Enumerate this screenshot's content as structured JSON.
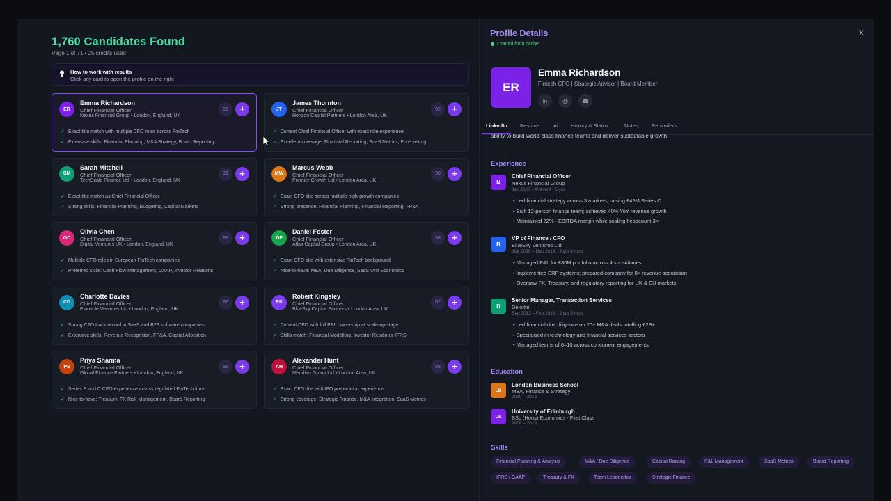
{
  "results": {
    "title": "1,760 Candidates Found",
    "subtitle": "Page 1 of 71 • 25 credits used",
    "hint_title": "How to work with results",
    "hint_text": "Click any card to open the profile on the right"
  },
  "candidates": [
    {
      "initials": "ER",
      "name": "Emma Richardson",
      "role": "Chief Financial Officer",
      "company": "Nexus Financial Group • London, England, UK",
      "score": "95",
      "r1": "Exact title match with multiple CFO roles across FinTech",
      "r2": "Extensive skills: Financial Planning, M&A Strategy, Board Reporting",
      "color": "#7c22e8"
    },
    {
      "initials": "JT",
      "name": "James Thornton",
      "role": "Chief Financial Officer",
      "company": "Horizon Capital Partners • London Area, UK",
      "score": "92",
      "r1": "Current Chief Financial Officer with exact role experience",
      "r2": "Excellent coverage: Financial Reporting, SaaS Metrics, Forecasting",
      "color": "#2563eb"
    },
    {
      "initials": "SM",
      "name": "Sarah Mitchell",
      "role": "Chief Financial Officer",
      "company": "TechScale Finance Ltd • London, England, UK",
      "score": "91",
      "r1": "Exact title match as Chief Financial Officer",
      "r2": "Strong skills: Financial Planning, Budgeting, Capital Markets",
      "color": "#0f9f74"
    },
    {
      "initials": "MW",
      "name": "Marcus Webb",
      "role": "Chief Financial Officer",
      "company": "Premier Growth Ltd • London Area, UK",
      "score": "90",
      "r1": "Exact CFO title across multiple high-growth companies",
      "r2": "Strong presence: Financial Planning, Financial Reporting, FP&A",
      "color": "#d9771a"
    },
    {
      "initials": "OC",
      "name": "Olivia Chen",
      "role": "Chief Financial Officer",
      "company": "Digital Ventures UK • London, England, UK",
      "score": "89",
      "r1": "Multiple CFO roles in European FinTech companies",
      "r2": "Preferred skills: Cash Flow Management, GAAP, Investor Relations",
      "color": "#db2777"
    },
    {
      "initials": "DF",
      "name": "Daniel Foster",
      "role": "Chief Financial Officer",
      "company": "Atlas Capital Group • London Area, UK",
      "score": "88",
      "r1": "Exact CFO title with extensive FinTech background",
      "r2": "Nice-to-have: M&A, Due Diligence, SaaS Unit Economics",
      "color": "#16a34a"
    },
    {
      "initials": "CD",
      "name": "Charlotte Davies",
      "role": "Chief Financial Officer",
      "company": "Pinnacle Ventures Ltd • London, England, UK",
      "score": "87",
      "r1": "Strong CFO track record in SaaS and B2B software companies",
      "r2": "Extensive skills: Revenue Recognition, FP&A, Capital Allocation",
      "color": "#0e8fb0"
    },
    {
      "initials": "RK",
      "name": "Robert Kingsley",
      "role": "Chief Financial Officer",
      "company": "BlueSky Capital Partners • London Area, UK",
      "score": "87",
      "r1": "Current CFO with full P&L ownership at scale-up stage",
      "r2": "Skills match: Financial Modelling, Investor Relations, IFRS",
      "color": "#7c3aed"
    },
    {
      "initials": "PS",
      "name": "Priya Sharma",
      "role": "Chief Financial Officer",
      "company": "Global Finance Partners • London, England, UK",
      "score": "86",
      "r1": "Series B and C CFO experience across regulated FinTech firms",
      "r2": "Nice-to-have: Treasury, FX Risk Management, Board Reporting",
      "color": "#c2410c"
    },
    {
      "initials": "AH",
      "name": "Alexander Hunt",
      "role": "Chief Financial Officer",
      "company": "Meridian Group Ltd • London Area, UK",
      "score": "85",
      "r1": "Exact CFO title with IPO preparation experience",
      "r2": "Strong coverage: Strategic Finance, M&A Integration, SaaS Metrics",
      "color": "#be123c"
    }
  ],
  "profile": {
    "panel_title": "Profile Details",
    "cache": "Loaded from cache",
    "close": "X",
    "initials": "ER",
    "name": "Emma Richardson",
    "headline": "Fintech CFO | Strategic Advisor | Board Member",
    "social": [
      "in",
      "@",
      "☎"
    ],
    "tabs": [
      "LinkedIn",
      "Resume",
      "Ai",
      "History & Status",
      "Notes",
      "Reminders"
    ],
    "summary_tail": "ability to build world-class finance teams and deliver sustainable growth.",
    "experience_label": "Experience",
    "experience": [
      {
        "logo": "N",
        "title": "Chief Financial Officer",
        "company": "Nexus Financial Group",
        "dates": "Jan 2020 – Present · 5 yrs",
        "bullets": [
          "Led financial strategy across 3 markets, raising £45M Series C",
          "Built 12-person finance team; achieved 40% YoY revenue growth",
          "Maintained 22%+ EBITDA margin while scaling headcount 3×"
        ],
        "color": "#7c22e8"
      },
      {
        "logo": "B",
        "title": "VP of Finance / CFO",
        "company": "BlueSky Ventures Ltd",
        "dates": "Mar 2016 – Dec 2019 · 3 yrs 9 mos",
        "bullets": [
          "Managed P&L for £80M portfolio across 4 subsidiaries",
          "Implemented ERP systems; prepared company for 8× revenue acquisition",
          "Oversaw FX, Treasury, and regulatory reporting for UK & EU markets"
        ],
        "color": "#2563eb"
      },
      {
        "logo": "D",
        "title": "Senior Manager, Transaction Services",
        "company": "Deloitte",
        "dates": "Sep 2012 – Feb 2016 · 3 yrs 5 mos",
        "bullets": [
          "Led financial due diligence on 20+ M&A deals totalling £2B+",
          "Specialised in technology and financial services sectors",
          "Managed teams of 6–10 across concurrent engagements"
        ],
        "color": "#0f9f74"
      }
    ],
    "education_label": "Education",
    "education": [
      {
        "logo": "LB",
        "school": "London Business School",
        "degree": "MBA, Finance & Strategy",
        "years": "2010 – 2012",
        "color": "#d9771a"
      },
      {
        "logo": "UE",
        "school": "University of Edinburgh",
        "degree": "BSc (Hons) Economics · First Class",
        "years": "2006 – 2010",
        "color": "#7c22e8"
      }
    ],
    "skills_label": "Skills",
    "skills": [
      "Financial Planning & Analysis",
      "M&A / Due Diligence",
      "Capital Raising",
      "P&L Management",
      "SaaS Metrics",
      "Board Reporting",
      "IFRS / GAAP",
      "Treasury & FX",
      "Team Leadership",
      "Strategic Finance"
    ]
  }
}
